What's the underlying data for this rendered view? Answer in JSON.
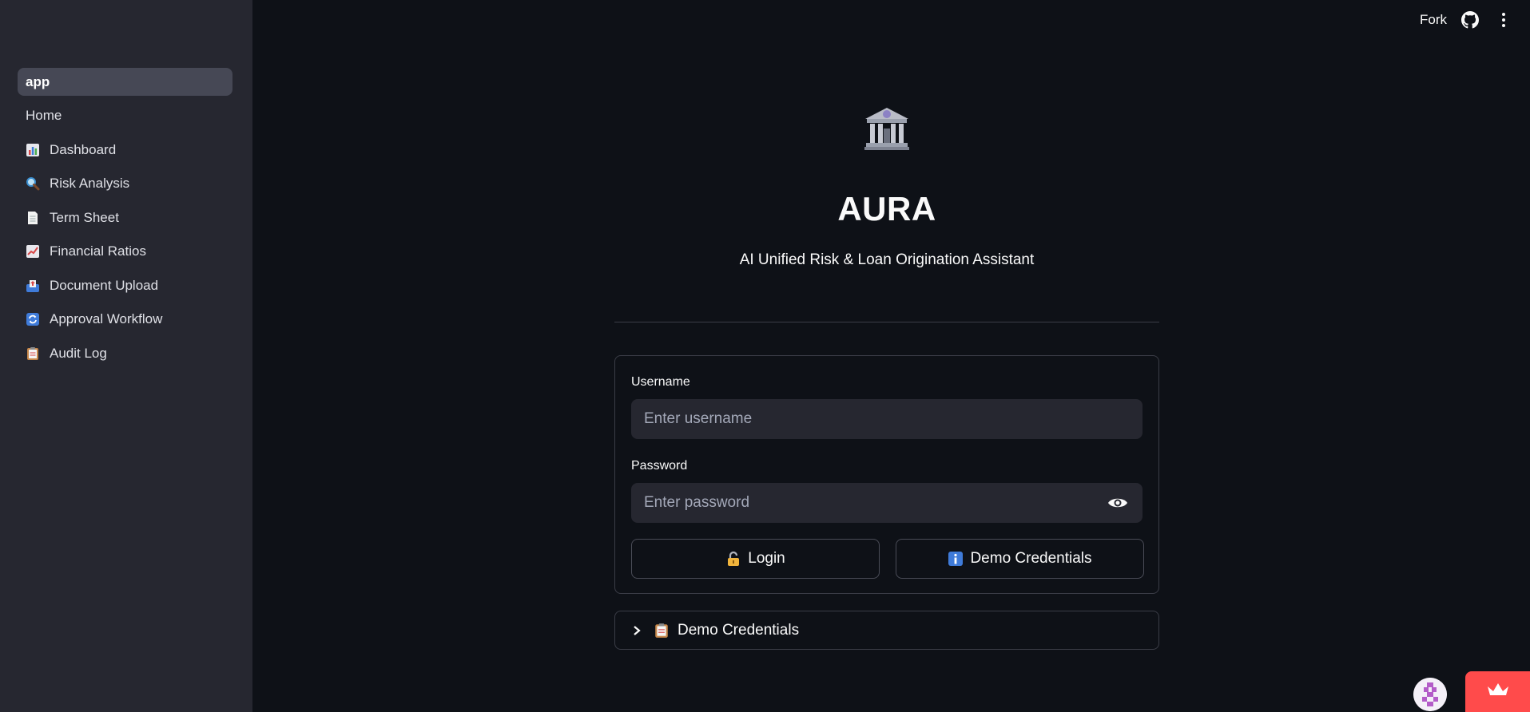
{
  "sidebar": {
    "items": [
      {
        "label": "app",
        "icon": ""
      },
      {
        "label": "Home",
        "icon": ""
      },
      {
        "label": "Dashboard",
        "icon": "bar-chart-icon"
      },
      {
        "label": "Risk Analysis",
        "icon": "magnifier-icon"
      },
      {
        "label": "Term Sheet",
        "icon": "page-icon"
      },
      {
        "label": "Financial Ratios",
        "icon": "trend-chart-icon"
      },
      {
        "label": "Document Upload",
        "icon": "outbox-icon"
      },
      {
        "label": "Approval Workflow",
        "icon": "refresh-icon"
      },
      {
        "label": "Audit Log",
        "icon": "clipboard-icon"
      }
    ]
  },
  "header": {
    "fork_label": "Fork",
    "github_icon": "github-icon",
    "menu_icon": "kebab-menu-icon"
  },
  "main": {
    "logo_icon": "bank-building-icon",
    "title": "AURA",
    "subtitle": "AI Unified Risk & Loan Origination Assistant"
  },
  "form": {
    "username_label": "Username",
    "username_placeholder": "Enter username",
    "password_label": "Password",
    "password_placeholder": "Enter password",
    "login_label": "Login",
    "login_icon": "lock-icon",
    "demo_label": "Demo Credentials",
    "demo_icon": "info-icon"
  },
  "expander": {
    "label": "Demo Credentials",
    "icon": "clipboard-icon"
  },
  "colors": {
    "background": "#0e1117",
    "sidebar": "#262730",
    "accent": "#ff4b4b",
    "input_bg": "#262730",
    "border": "#3b3d47"
  }
}
